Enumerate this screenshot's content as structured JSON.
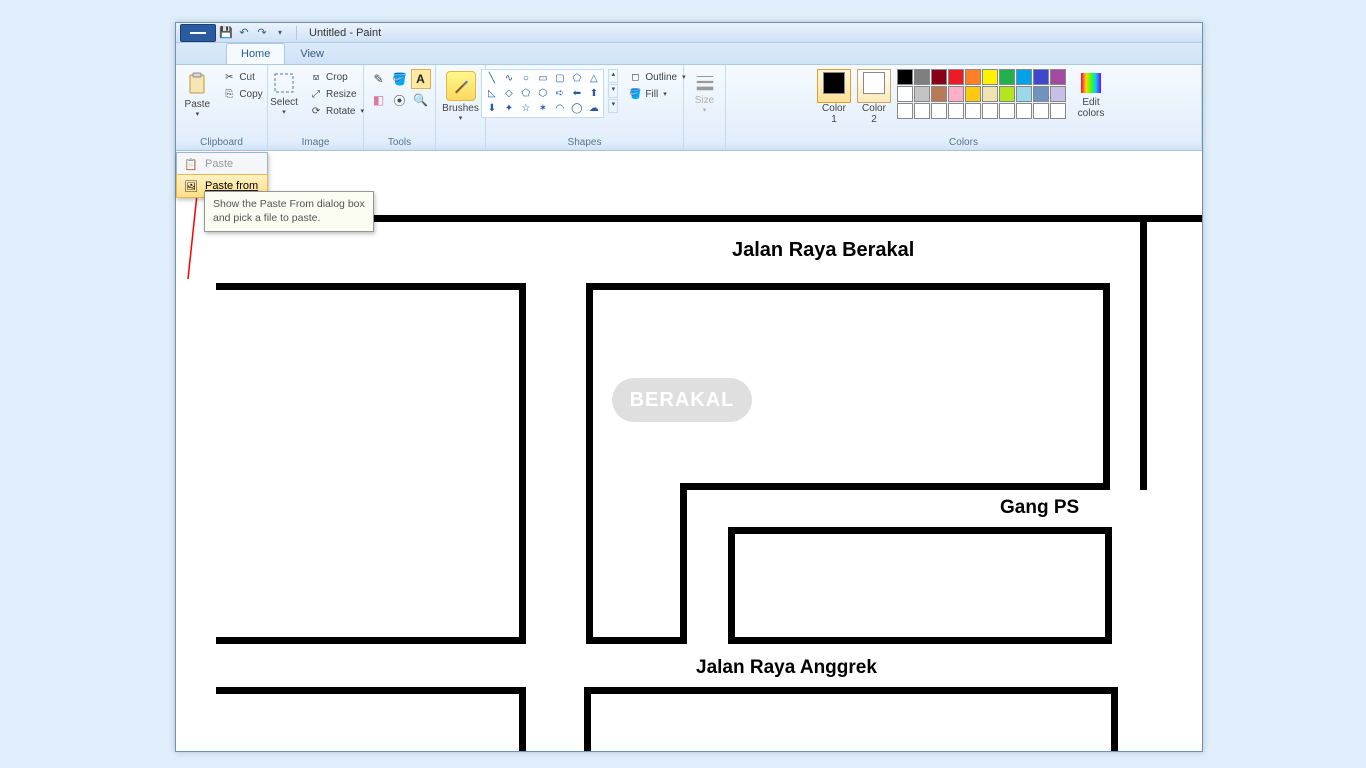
{
  "titlebar": {
    "title": "Untitled - Paint"
  },
  "tabs": {
    "home": "Home",
    "view": "View"
  },
  "ribbon": {
    "clipboard": {
      "paste": "Paste",
      "cut": "Cut",
      "copy": "Copy",
      "label": "Clipboard"
    },
    "image": {
      "select": "Select",
      "crop": "Crop",
      "resize": "Resize",
      "rotate": "Rotate",
      "label": "Image"
    },
    "tools": {
      "label": "Tools"
    },
    "brushes": {
      "label": "Brushes",
      "btn": "Brushes"
    },
    "shapes": {
      "outline": "Outline",
      "fill": "Fill",
      "label": "Shapes"
    },
    "size": {
      "label": "Size",
      "btn": "Size"
    },
    "colors": {
      "color1": "Color\n1",
      "color2": "Color\n2",
      "edit": "Edit\ncolors",
      "label": "Colors"
    }
  },
  "palette": {
    "row1": [
      "#000000",
      "#7f7f7f",
      "#880015",
      "#ed1c24",
      "#ff7f27",
      "#fff200",
      "#22b14c",
      "#00a2e8",
      "#3f48cc",
      "#a349a4"
    ],
    "row2": [
      "#ffffff",
      "#c3c3c3",
      "#b97a57",
      "#ffaec9",
      "#ffc90e",
      "#efe4b0",
      "#b5e61d",
      "#99d9ea",
      "#7092be",
      "#c8bfe7"
    ],
    "row3": [
      "#ffffff",
      "#ffffff",
      "#ffffff",
      "#ffffff",
      "#ffffff",
      "#ffffff",
      "#ffffff",
      "#ffffff",
      "#ffffff",
      "#ffffff"
    ]
  },
  "color1": "#000000",
  "color2": "#ffffff",
  "dropdown": {
    "paste": "Paste",
    "paste_from": "Paste from"
  },
  "tooltip": "Show the Paste From dialog box and pick a file to paste.",
  "canvas": {
    "label1": "Jalan Raya Berakal",
    "label2": "Gang PS",
    "label3": "Jalan Raya Anggrek",
    "watermark": "BERAKAL"
  }
}
